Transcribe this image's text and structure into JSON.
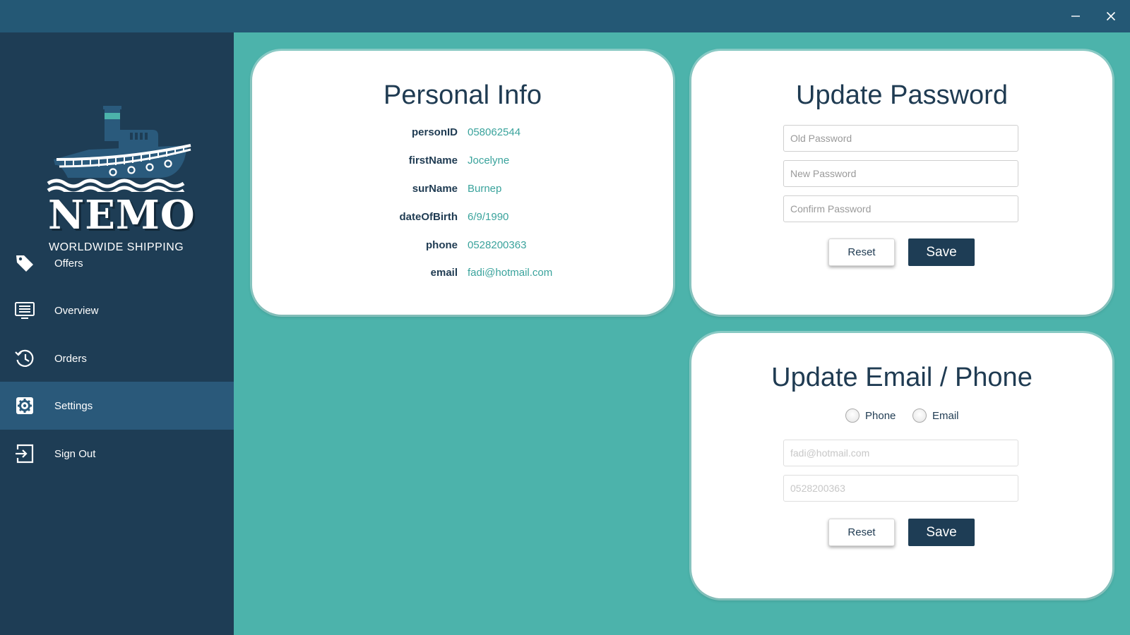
{
  "window": {
    "minimize_icon": "minimize-icon",
    "close_icon": "close-icon"
  },
  "brand": {
    "name": "NEMO",
    "tagline": "WORLDWIDE SHIPPING"
  },
  "sidebar": {
    "items": [
      {
        "label": "Offers",
        "icon": "tag-icon"
      },
      {
        "label": "Overview",
        "icon": "list-icon"
      },
      {
        "label": "Orders",
        "icon": "history-icon"
      },
      {
        "label": "Settings",
        "icon": "gear-icon",
        "active": true
      },
      {
        "label": "Sign Out",
        "icon": "sign-out-icon"
      }
    ]
  },
  "personal_info": {
    "title": "Personal Info",
    "fields": [
      {
        "key": "personID",
        "value": "058062544"
      },
      {
        "key": "firstName",
        "value": "Jocelyne"
      },
      {
        "key": "surName",
        "value": "Burnep"
      },
      {
        "key": "dateOfBirth",
        "value": "6/9/1990"
      },
      {
        "key": "phone",
        "value": "0528200363"
      },
      {
        "key": "email",
        "value": "fadi@hotmail.com"
      }
    ]
  },
  "update_password": {
    "title": "Update Password",
    "old_placeholder": "Old Password",
    "new_placeholder": "New Password",
    "confirm_placeholder": "Confirm Password",
    "reset_label": "Reset",
    "save_label": "Save"
  },
  "update_contact": {
    "title": "Update Email / Phone",
    "radio_phone": "Phone",
    "radio_email": "Email",
    "email_value": "fadi@hotmail.com",
    "phone_value": "0528200363",
    "reset_label": "Reset",
    "save_label": "Save"
  },
  "colors": {
    "sidebar_bg": "#1e3d55",
    "active_item_bg": "#2a597a",
    "titlebar_bg": "#245875",
    "content_bg": "#4cb3ab",
    "accent_text": "#3aa39c",
    "save_button_bg": "#1e3d55"
  }
}
